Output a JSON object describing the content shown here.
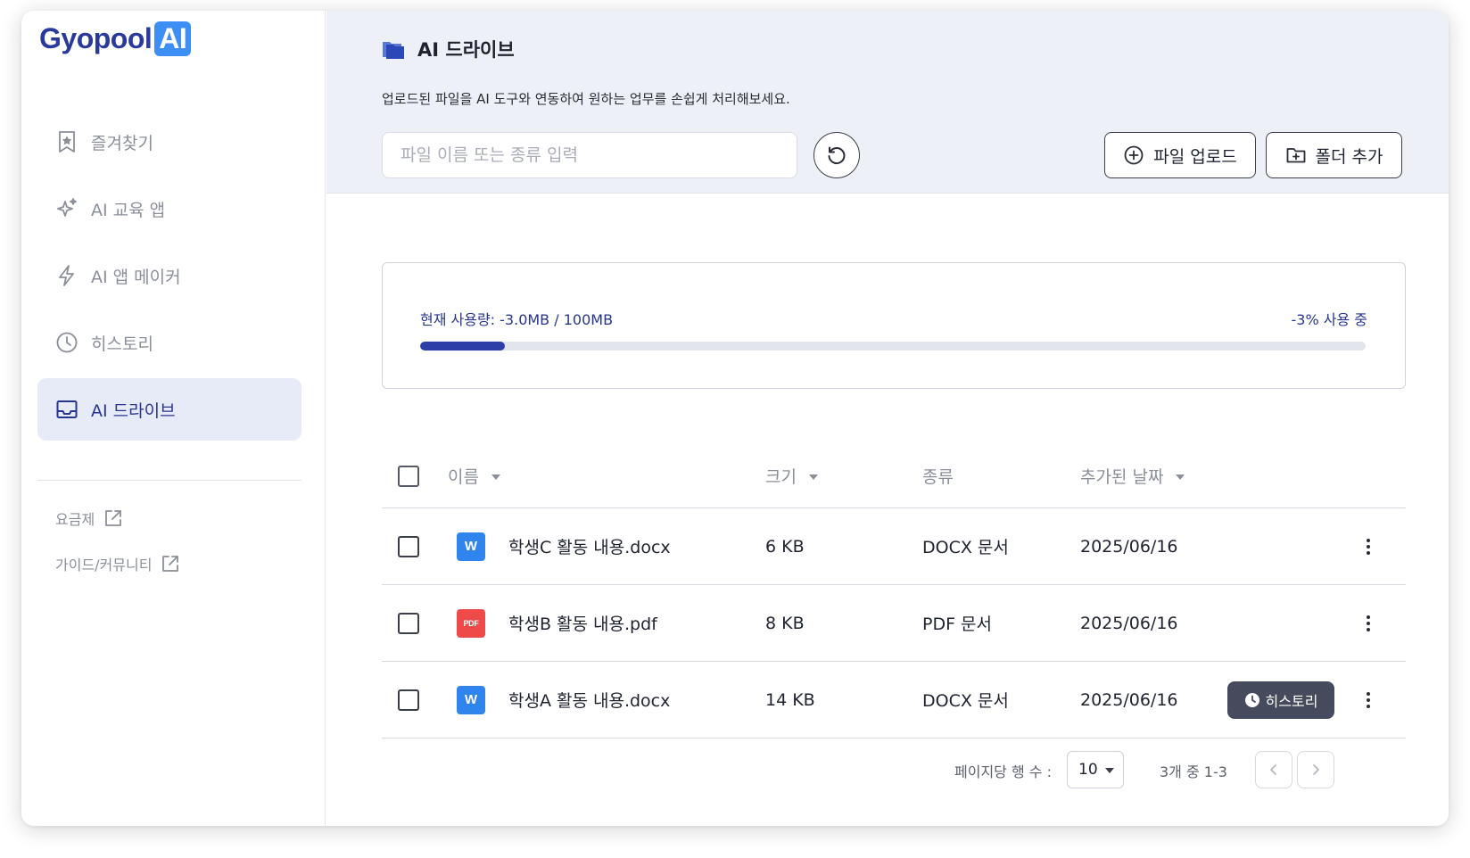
{
  "brand": {
    "name": "Gyopool",
    "suffix": "AI"
  },
  "sidebar": {
    "items": [
      {
        "label": "즐겨찾기",
        "icon": "bookmark-star-icon",
        "active": false
      },
      {
        "label": "AI 교육 앱",
        "icon": "sparkle-icon",
        "active": false
      },
      {
        "label": "AI 앱 메이커",
        "icon": "lightning-icon",
        "active": false
      },
      {
        "label": "히스토리",
        "icon": "clock-icon",
        "active": false
      },
      {
        "label": "AI 드라이브",
        "icon": "inbox-tray-icon",
        "active": true
      }
    ],
    "links": [
      {
        "label": "요금제",
        "icon": "external-link-icon"
      },
      {
        "label": "가이드/커뮤니티",
        "icon": "external-link-icon"
      }
    ]
  },
  "header": {
    "title": "AI 드라이브",
    "subtitle": "업로드된 파일을 AI 도구와 연동하여 원하는 업무를 손쉽게 처리해보세요.",
    "search_placeholder": "파일 이름 또는 종류 입력",
    "upload_label": "파일 업로드",
    "add_folder_label": "폴더 추가"
  },
  "usage": {
    "label": "현재 사용량: -3.0MB / 100MB",
    "percent_label": "-3% 사용 중",
    "fill_fraction": 0.09,
    "accent_color": "#2d3ea8"
  },
  "table": {
    "headers": {
      "name": "이름",
      "size": "크기",
      "type": "종류",
      "date": "추가된 날짜"
    },
    "rows": [
      {
        "name": "학생C 활동 내용.docx",
        "icon": "word-file-icon",
        "icon_text": "W",
        "size": "6 KB",
        "type": "DOCX 문서",
        "date": "2025/06/16",
        "history": false
      },
      {
        "name": "학생B 활동 내용.pdf",
        "icon": "pdf-file-icon",
        "icon_text": "PDF",
        "size": "8 KB",
        "type": "PDF 문서",
        "date": "2025/06/16",
        "history": false
      },
      {
        "name": "학생A 활동 내용.docx",
        "icon": "word-file-icon",
        "icon_text": "W",
        "size": "14 KB",
        "type": "DOCX 문서",
        "date": "2025/06/16",
        "history": true,
        "history_label": "히스토리"
      }
    ]
  },
  "pagination": {
    "rows_per_page_label": "페이지당 행 수 :",
    "rows_per_page": "10",
    "range_label": "3개 중 1-3"
  }
}
